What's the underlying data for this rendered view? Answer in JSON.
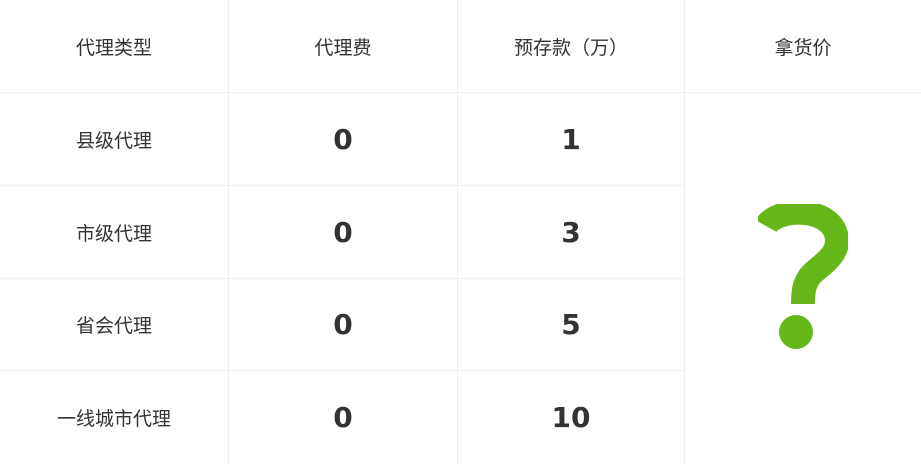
{
  "table": {
    "headers": [
      "代理类型",
      "代理费",
      "预存款（万）",
      "拿货价"
    ],
    "rows": [
      {
        "type": "县级代理",
        "fee": "0",
        "deposit": "1"
      },
      {
        "type": "市级代理",
        "fee": "0",
        "deposit": "3"
      },
      {
        "type": "省会代理",
        "fee": "0",
        "deposit": "5"
      },
      {
        "type": "一线城市代理",
        "fee": "0",
        "deposit": "10"
      }
    ],
    "price_placeholder_icon": "question-mark-icon",
    "accent_color": "#66b81a"
  }
}
